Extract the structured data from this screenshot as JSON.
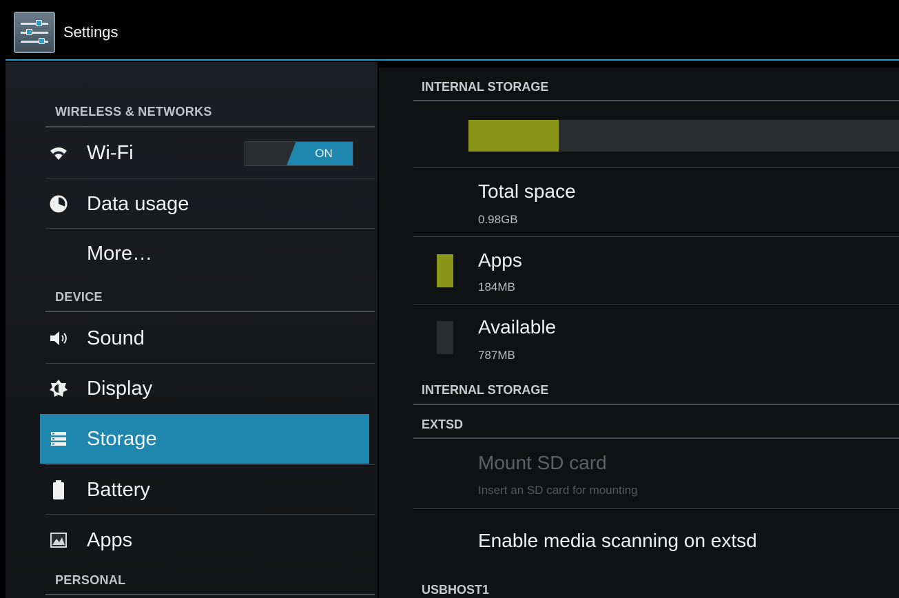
{
  "action_bar": {
    "title": "Settings",
    "icon": "settings-sliders-icon"
  },
  "left_nav": {
    "sections": [
      {
        "header": "WIRELESS & NETWORKS"
      },
      {
        "header": "DEVICE"
      },
      {
        "header": "PERSONAL"
      }
    ],
    "items": [
      {
        "label": "Wi-Fi",
        "icon": "wifi-icon",
        "toggle": "ON"
      },
      {
        "label": "Data usage",
        "icon": "data-usage-icon"
      },
      {
        "label": "More…"
      },
      {
        "label": "Sound",
        "icon": "speaker-icon"
      },
      {
        "label": "Display",
        "icon": "brightness-icon"
      },
      {
        "label": "Storage",
        "icon": "storage-icon",
        "selected": true
      },
      {
        "label": "Battery",
        "icon": "battery-icon"
      },
      {
        "label": "Apps",
        "icon": "apps-icon"
      }
    ],
    "colors": {
      "selected": "#1f86ae"
    }
  },
  "storage": {
    "internal_header": "INTERNAL STORAGE",
    "usage_fraction": 0.21,
    "colors": {
      "apps": "#8a9618",
      "available": "#2a2c2e",
      "accent": "#2b9cc8"
    },
    "rows": [
      {
        "title": "Total space",
        "value": "0.98GB"
      },
      {
        "title": "Apps",
        "value": "184MB"
      },
      {
        "title": "Available",
        "value": "787MB"
      }
    ],
    "internal_header_2": "INTERNAL STORAGE",
    "extsd_header": "EXTSD",
    "mount": {
      "title": "Mount SD card",
      "summary": "Insert an SD card for mounting",
      "enabled": false
    },
    "media_scan": {
      "title": "Enable media scanning on extsd"
    },
    "usbhost_header": "USBHOST1"
  }
}
